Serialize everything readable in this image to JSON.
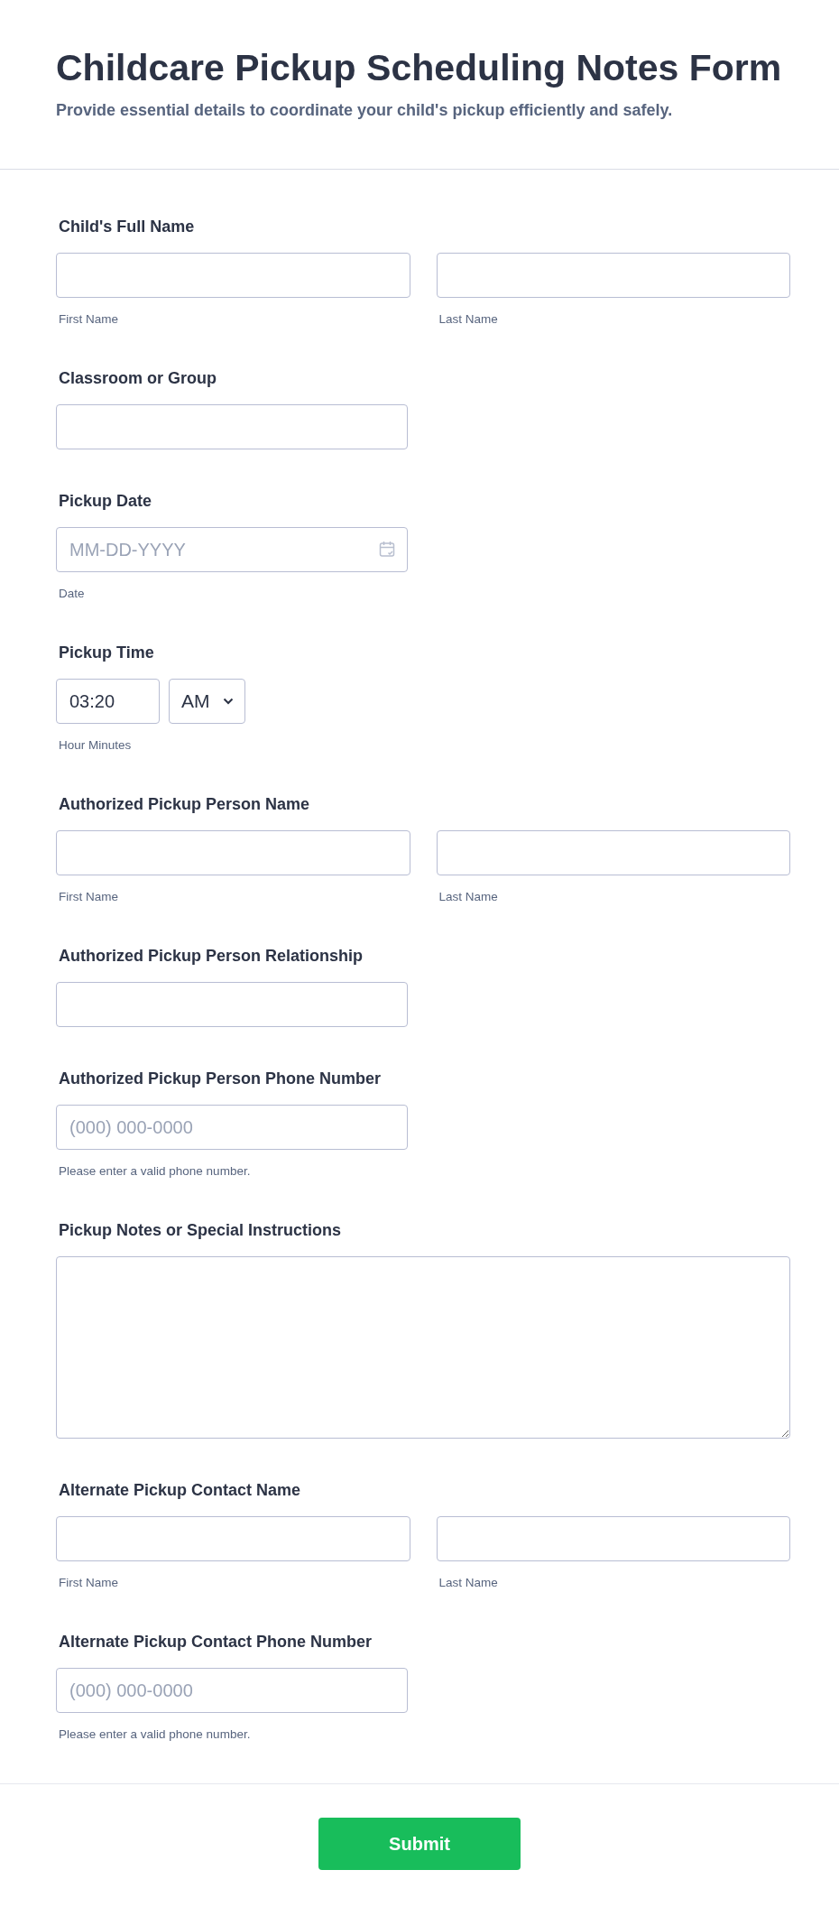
{
  "header": {
    "title": "Childcare Pickup Scheduling Notes Form",
    "subtitle": "Provide essential details to coordinate your child's pickup efficiently and safely."
  },
  "fields": [
    {
      "kind": "name",
      "label": "Child's Full Name",
      "sublabels": [
        "First Name",
        "Last Name"
      ]
    },
    {
      "kind": "text",
      "label": "Classroom or Group"
    },
    {
      "kind": "date",
      "label": "Pickup Date",
      "placeholder": "MM-DD-YYYY",
      "sublabel": "Date"
    },
    {
      "kind": "time",
      "label": "Pickup Time",
      "value": "03:20",
      "period": "AM",
      "sublabel": "Hour Minutes"
    },
    {
      "kind": "name",
      "label": "Authorized Pickup Person Name",
      "sublabels": [
        "First Name",
        "Last Name"
      ]
    },
    {
      "kind": "text",
      "label": "Authorized Pickup Person Relationship"
    },
    {
      "kind": "phone",
      "label": "Authorized Pickup Person Phone Number",
      "placeholder": "(000) 000-0000",
      "sublabel": "Please enter a valid phone number."
    },
    {
      "kind": "textarea",
      "label": "Pickup Notes or Special Instructions"
    },
    {
      "kind": "name",
      "label": "Alternate Pickup Contact Name",
      "sublabels": [
        "First Name",
        "Last Name"
      ]
    },
    {
      "kind": "phone",
      "label": "Alternate Pickup Contact Phone Number",
      "placeholder": "(000) 000-0000",
      "sublabel": "Please enter a valid phone number."
    }
  ],
  "submit": {
    "label": "Submit"
  }
}
